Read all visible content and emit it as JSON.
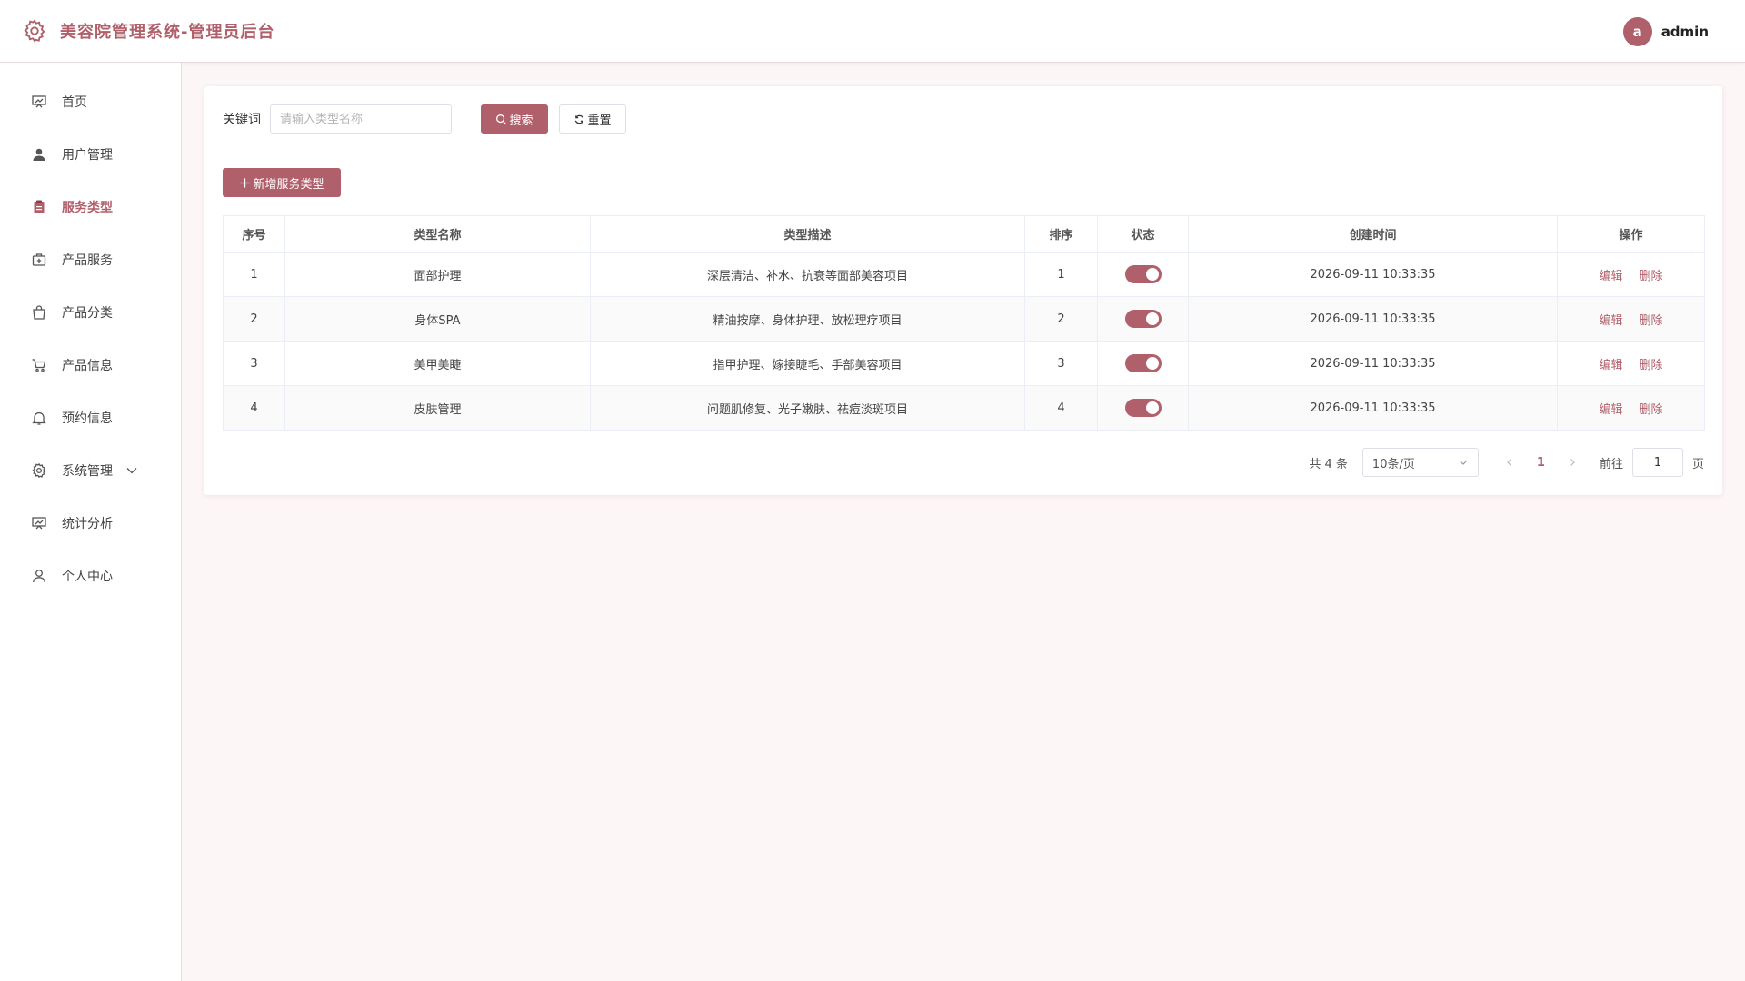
{
  "header": {
    "title": "美容院管理系统-管理员后台",
    "avatar_letter": "a",
    "username": "admin",
    "brand_icon": "gear-icon",
    "accent_color": "#b0606b"
  },
  "sidebar": {
    "items": [
      {
        "label": "首页",
        "icon": "dashboard-icon",
        "active": false
      },
      {
        "label": "用户管理",
        "icon": "user-icon",
        "active": false
      },
      {
        "label": "服务类型",
        "icon": "clipboard-icon",
        "active": true
      },
      {
        "label": "产品服务",
        "icon": "medkit-icon",
        "active": false
      },
      {
        "label": "产品分类",
        "icon": "bag-icon",
        "active": false
      },
      {
        "label": "产品信息",
        "icon": "cart-icon",
        "active": false
      },
      {
        "label": "预约信息",
        "icon": "bell-icon",
        "active": false
      },
      {
        "label": "系统管理",
        "icon": "gear-icon",
        "active": false,
        "expandable": true
      },
      {
        "label": "统计分析",
        "icon": "chart-board-icon",
        "active": false
      },
      {
        "label": "个人中心",
        "icon": "person-icon",
        "active": false
      }
    ]
  },
  "search": {
    "label": "关键词",
    "placeholder": "请输入类型名称",
    "value": "",
    "search_label": "搜索",
    "reset_label": "重置"
  },
  "toolbar": {
    "add_label": "新增服务类型"
  },
  "table": {
    "columns": [
      "序号",
      "类型名称",
      "类型描述",
      "排序",
      "状态",
      "创建时间",
      "操作"
    ],
    "rows": [
      {
        "index": "1",
        "name": "面部护理",
        "desc": "深层清洁、补水、抗衰等面部美容项目",
        "sort": "1",
        "enabled": true,
        "created": "2026-09-11 10:33:35"
      },
      {
        "index": "2",
        "name": "身体SPA",
        "desc": "精油按摩、身体护理、放松理疗项目",
        "sort": "2",
        "enabled": true,
        "created": "2026-09-11 10:33:35"
      },
      {
        "index": "3",
        "name": "美甲美睫",
        "desc": "指甲护理、嫁接睫毛、手部美容项目",
        "sort": "3",
        "enabled": true,
        "created": "2026-09-11 10:33:35"
      },
      {
        "index": "4",
        "name": "皮肤管理",
        "desc": "问题肌修复、光子嫩肤、祛痘淡斑项目",
        "sort": "4",
        "enabled": true,
        "created": "2026-09-11 10:33:35"
      }
    ],
    "edit_label": "编辑",
    "delete_label": "删除"
  },
  "pagination": {
    "total_text": "共 4 条",
    "page_size": "10条/页",
    "current_page": "1",
    "goto_label": "前往",
    "goto_value": "1",
    "goto_suffix": "页"
  }
}
